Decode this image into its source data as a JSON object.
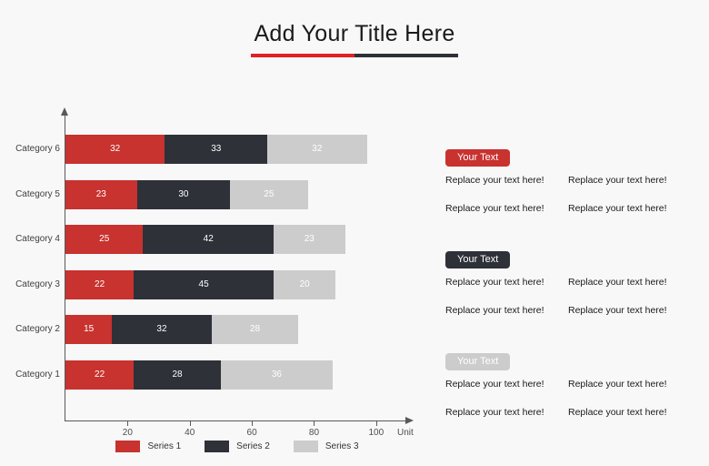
{
  "title": {
    "text": "Add Your Title Here"
  },
  "chart_data": {
    "type": "bar",
    "orientation": "horizontal",
    "stacked": true,
    "title": "Add Your Title Here",
    "xlabel": "Unit",
    "ylabel": "",
    "xlim": [
      0,
      110
    ],
    "xticks": [
      20,
      40,
      60,
      80,
      100
    ],
    "grid": false,
    "legend_position": "bottom",
    "categories": [
      "Category 1",
      "Category 2",
      "Category 3",
      "Category 4",
      "Category 5",
      "Category 6"
    ],
    "series": [
      {
        "name": "Series 1",
        "color": "#c8322f",
        "values": [
          22,
          15,
          22,
          25,
          23,
          32
        ]
      },
      {
        "name": "Series 2",
        "color": "#2e3137",
        "values": [
          28,
          32,
          45,
          42,
          30,
          33
        ]
      },
      {
        "name": "Series 3",
        "color": "#cccccc",
        "values": [
          36,
          28,
          20,
          23,
          25,
          32
        ]
      }
    ],
    "rows": [
      {
        "category": "Category 6",
        "segments": [
          {
            "series": "Series 1",
            "value": 32
          },
          {
            "series": "Series 2",
            "value": 33
          },
          {
            "series": "Series 3",
            "value": 32
          }
        ]
      },
      {
        "category": "Category 5",
        "segments": [
          {
            "series": "Series 1",
            "value": 23
          },
          {
            "series": "Series 2",
            "value": 30
          },
          {
            "series": "Series 3",
            "value": 25
          }
        ]
      },
      {
        "category": "Category 4",
        "segments": [
          {
            "series": "Series 1",
            "value": 25
          },
          {
            "series": "Series 2",
            "value": 42
          },
          {
            "series": "Series 3",
            "value": 23
          }
        ]
      },
      {
        "category": "Category 3",
        "segments": [
          {
            "series": "Series 1",
            "value": 22
          },
          {
            "series": "Series 2",
            "value": 45
          },
          {
            "series": "Series 3",
            "value": 20
          }
        ]
      },
      {
        "category": "Category 2",
        "segments": [
          {
            "series": "Series 1",
            "value": 15
          },
          {
            "series": "Series 2",
            "value": 32
          },
          {
            "series": "Series 3",
            "value": 28
          }
        ]
      },
      {
        "category": "Category 1",
        "segments": [
          {
            "series": "Series 1",
            "value": 22
          },
          {
            "series": "Series 2",
            "value": 28
          },
          {
            "series": "Series 3",
            "value": 36
          }
        ]
      }
    ]
  },
  "legend": [
    {
      "label": "Series 1",
      "color": "#c8322f"
    },
    {
      "label": "Series 2",
      "color": "#2e3137"
    },
    {
      "label": "Series 3",
      "color": "#cccccc"
    }
  ],
  "text_panel": {
    "blocks": [
      {
        "badge": "Your Text",
        "badge_style": "red",
        "lines": [
          "Replace your text here!",
          "Replace your text here!",
          "Replace your text here!",
          "Replace your text here!"
        ]
      },
      {
        "badge": "Your Text",
        "badge_style": "dark",
        "lines": [
          "Replace your text here!",
          "Replace your text here!",
          "Replace your text here!",
          "Replace your text here!"
        ]
      },
      {
        "badge": "Your Text",
        "badge_style": "gray",
        "lines": [
          "Replace your text here!",
          "Replace your text here!",
          "Replace your text here!",
          "Replace your text here!"
        ]
      }
    ]
  },
  "colors": {
    "series1": "#c8322f",
    "series2": "#2e3137",
    "series3": "#cccccc",
    "title_rule_left": "#e21f26",
    "title_rule_right": "#2e3137",
    "background": "#f8f8f8"
  }
}
